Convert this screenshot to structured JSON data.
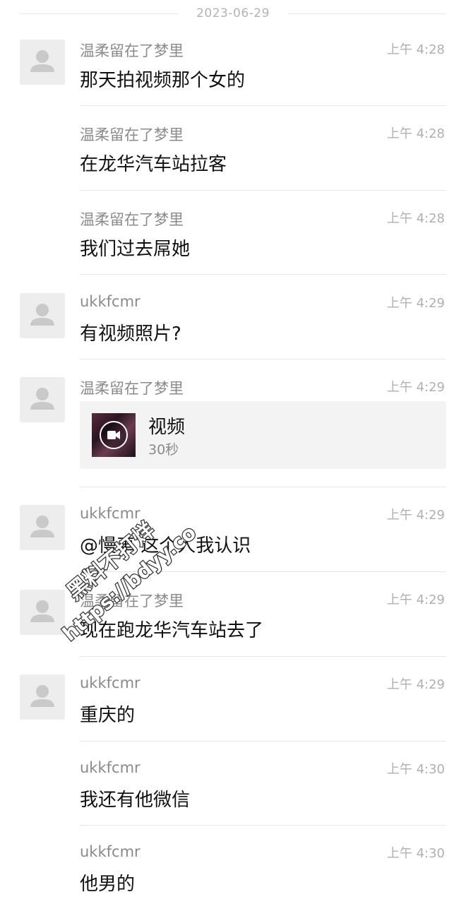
{
  "chat": {
    "date": "2023-06-29",
    "messages": [
      {
        "sender": "温柔留在了梦里",
        "time": "上午 4:28",
        "text": "那天拍视频那个女的"
      },
      {
        "sender": "温柔留在了梦里",
        "time": "上午 4:28",
        "text": "在龙华汽车站拉客"
      },
      {
        "sender": "温柔留在了梦里",
        "time": "上午 4:28",
        "text": "我们过去屌她"
      },
      {
        "sender": "ukkfcmr",
        "time": "上午 4:29",
        "text": "有视频照片?"
      },
      {
        "sender": "温柔留在了梦里",
        "time": "上午 4:29",
        "video": {
          "title": "视频",
          "duration": "30秒"
        }
      },
      {
        "sender": "ukkfcmr",
        "time": "上午 4:29",
        "text": "@慢車 这个人我认识"
      },
      {
        "sender": "温柔留在了梦里",
        "time": "上午 4:29",
        "text": "现在跑龙华汽车站去了"
      },
      {
        "sender": "ukkfcmr",
        "time": "上午 4:29",
        "text": "重庆的"
      },
      {
        "sender": "ukkfcmr",
        "time": "上午 4:30",
        "text": "我还有他微信"
      },
      {
        "sender": "ukkfcmr",
        "time": "上午 4:30",
        "text": "他男的"
      }
    ]
  },
  "watermark": {
    "line1": "黑料不打烊",
    "line2": "https://bdyy.co"
  },
  "colors": {
    "avatar_bg": "#ededed",
    "avatar_figure": "#c9c9c9",
    "divider": "#e6e6e6",
    "watermark": "#ffffff"
  }
}
